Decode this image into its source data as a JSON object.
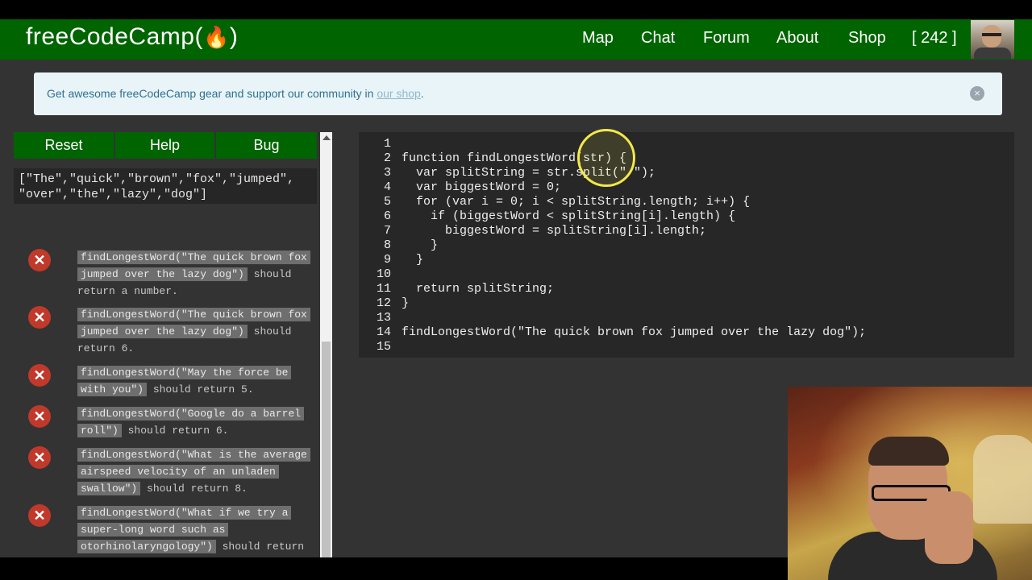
{
  "header": {
    "brand": "freeCodeCamp(",
    "brand_flame": "🔥",
    "brand_close": ")",
    "nav": [
      "Map",
      "Chat",
      "Forum",
      "About",
      "Shop",
      "[ 242 ]"
    ]
  },
  "banner": {
    "text": "Get awesome freeCodeCamp gear and support our community in ",
    "link": "our shop",
    "tail": ".",
    "close": "×"
  },
  "buttons": {
    "reset": "Reset",
    "help": "Help",
    "bug": "Bug"
  },
  "output": {
    "lines": [
      "[\"The\",\"quick\",\"brown\",\"fox\",\"jumped\",",
      "\"over\",\"the\",\"lazy\",\"dog\"]"
    ]
  },
  "tests": [
    {
      "code": "findLongestWord(\"The quick brown fox jumped over the lazy dog\")",
      "desc": " should return a number."
    },
    {
      "code": "findLongestWord(\"The quick brown fox jumped over the lazy dog\")",
      "desc": " should return 6."
    },
    {
      "code": "findLongestWord(\"May the force be with you\")",
      "desc": " should return 5."
    },
    {
      "code": "findLongestWord(\"Google do a barrel roll\")",
      "desc": " should return 6."
    },
    {
      "code": "findLongestWord(\"What is the average airspeed velocity of an unladen swallow\")",
      "desc": " should return 8."
    },
    {
      "code": "findLongestWord(\"What if we try a super-long word such as otorhinolaryngology\")",
      "desc": " should return"
    }
  ],
  "editor": {
    "line_numbers": [
      "1",
      "2",
      "3",
      "4",
      "5",
      "6",
      "7",
      "8",
      "9",
      "10",
      "11",
      "12",
      "13",
      "14",
      "15"
    ],
    "lines": [
      "",
      "function findLongestWord(str) {",
      "  var splitString = str.split(\" \");",
      "  var biggestWord = 0;",
      "  for (var i = 0; i < splitString.length; i++) {",
      "    if (biggestWord < splitString[i].length) {",
      "      biggestWord = splitString[i].length;",
      "    }",
      "  }",
      "",
      "  return splitString;",
      "}",
      "",
      "findLongestWord(\"The quick brown fox jumped over the lazy dog\");",
      ""
    ]
  },
  "colors": {
    "brand_green": "#006400",
    "fail_red": "#c0392b",
    "editor_bg": "#272727",
    "cursor_highlight": "#f2e84a"
  }
}
